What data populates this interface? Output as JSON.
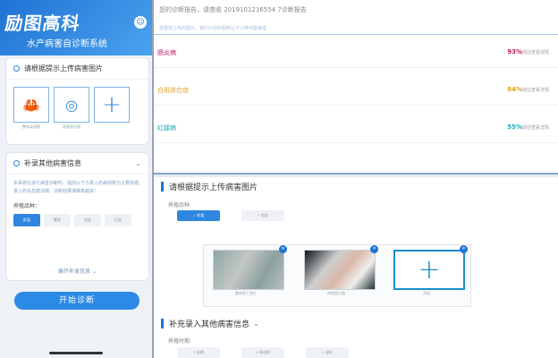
{
  "app": {
    "brand": "励图高科",
    "subtitle": "水产病害自诊断系统"
  },
  "upload_card": {
    "title": "请根据提示上传病害图片",
    "thumbs": [
      {
        "icon": "crab-icon",
        "glyph": "🦀",
        "label": "整体染测图"
      },
      {
        "icon": "target-icon",
        "glyph": "◎",
        "label": "病害部位图"
      },
      {
        "icon": "plus-icon",
        "glyph": "+",
        "label": ""
      }
    ]
  },
  "supplement_card": {
    "title": "补录其他病害信息",
    "note": "本系统在进行病害诊断时，提前以下方录入的病例数为主要依据,录入的信息越详细，诊断结果准确率越高！",
    "species_label": "养殖品种：",
    "chips": [
      "虾类",
      "蟹类",
      "鱼类",
      "贝类"
    ],
    "active_chip": 0,
    "expand_label": "展开补录信息"
  },
  "start_button": "开始诊断",
  "report": {
    "header": "您的诊断报告，请查收    2019101216554 7诊断报告",
    "hint": "根据您上传的图片，我们为您匹配到以下三种可能病害",
    "diseases": [
      {
        "name": "肠炎病",
        "pct": "93%",
        "color": "#c2185b",
        "link": "前往查看详情"
      },
      {
        "name": "白斑综合症",
        "pct": "84%",
        "color": "#e0a020",
        "link": "前往查看详情"
      },
      {
        "name": "红腿病",
        "pct": "55%",
        "color": "#19a8b5",
        "link": "前往查看详情"
      }
    ]
  },
  "upload_section": {
    "title": "请根据提示上传病害图片",
    "species_label": "养殖品种",
    "selected": "虾类",
    "other": "鱼类",
    "photos": [
      {
        "caption": "整体死亡图片"
      },
      {
        "caption": "病害部位图"
      },
      {
        "caption": "添加"
      }
    ]
  },
  "extra_section": {
    "title": "补充录入其他病害信息",
    "field_label": "养殖时期",
    "options": [
      "苗期",
      "养成期",
      "成虾"
    ]
  }
}
